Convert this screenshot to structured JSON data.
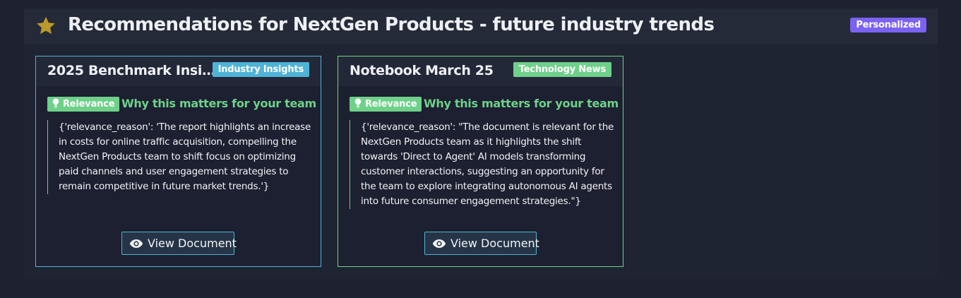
{
  "header": {
    "title": "Recommendations for NextGen Products - future industry trends",
    "badge": "Personalized",
    "icon": "star-icon"
  },
  "colors": {
    "background": "#1d2130",
    "accent_purple": "#7b62f0",
    "industry_blue": "#4fb3d6",
    "tech_green": "#6fd08a",
    "star_gold": "#b8992a"
  },
  "cards": [
    {
      "title": "2025 Benchmark Insight...",
      "category": "Industry Insights",
      "relevance_label": "Relevance",
      "relevance_heading": "Why this matters for your team",
      "reason": "{'relevance_reason': 'The report highlights an increase in costs for online traffic acquisition, compelling the NextGen Products team to shift focus on optimizing paid channels and user engagement strategies to remain competitive in future market trends.'}",
      "button": "View Document"
    },
    {
      "title": "Notebook March 25",
      "category": "Technology News",
      "relevance_label": "Relevance",
      "relevance_heading": "Why this matters for your team",
      "reason": "{'relevance_reason': \"The document is relevant for the NextGen Products team as it highlights the shift towards 'Direct to Agent' AI models transforming customer interactions, suggesting an opportunity for the team to explore integrating autonomous AI agents into future consumer engagement strategies.\"}",
      "button": "View Document"
    }
  ]
}
